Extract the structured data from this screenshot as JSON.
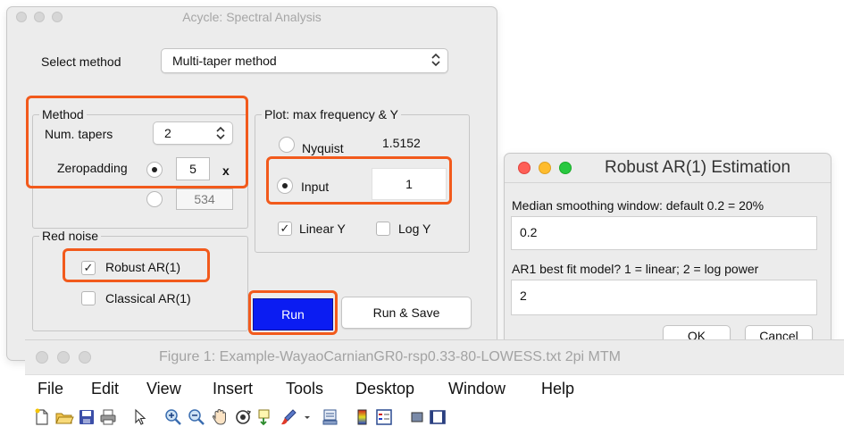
{
  "main_window": {
    "title": "Acycle: Spectral Analysis",
    "select_method_label": "Select method",
    "method_value": "Multi-taper method",
    "method_group": {
      "title": "Method",
      "num_tapers_label": "Num. tapers",
      "num_tapers_value": "2",
      "zeropadding_label": "Zeropadding",
      "zeropadding_value": "5",
      "zeropadding_unit": "x",
      "alt_value": "534"
    },
    "plot_group": {
      "title": "Plot: max frequency & Y",
      "nyquist_label": "Nyquist",
      "nyquist_value": "1.5152",
      "input_label": "Input",
      "input_value": "1",
      "linear_y_label": "Linear Y",
      "log_y_label": "Log Y"
    },
    "red_noise_group": {
      "title": "Red noise",
      "robust_label": "Robust AR(1)",
      "classical_label": "Classical AR(1)"
    },
    "run_label": "Run",
    "run_save_label": "Run & Save",
    "check_mark": "✓"
  },
  "dialog": {
    "title": "Robust AR(1) Estimation",
    "smoothing_prompt": "Median smoothing window: default 0.2 = 20%",
    "smoothing_value": "0.2",
    "model_prompt": "AR1 best fit model? 1 = linear; 2 = log power",
    "model_value": "2",
    "ok_label": "OK",
    "cancel_label": "Cancel"
  },
  "figure_window": {
    "title": "Figure 1: Example-WayaoCarnianGR0-rsp0.33-80-LOWESS.txt 2pi MTM",
    "menu": [
      "File",
      "Edit",
      "View",
      "Insert",
      "Tools",
      "Desktop",
      "Window",
      "Help"
    ],
    "toolbar_icons": [
      "new-figure-icon",
      "open-folder-icon",
      "save-icon",
      "print-icon",
      "pointer-icon",
      "zoom-in-icon",
      "zoom-out-icon",
      "pan-hand-icon",
      "rotate-3d-icon",
      "data-cursor-icon",
      "brush-icon",
      "link-plot-icon",
      "colorbar-icon",
      "legend-icon",
      "hide-plot-tools-icon",
      "show-plot-tools-icon"
    ]
  },
  "colors": {
    "highlight": "#f25a1c",
    "run_button": "#0b1cf2",
    "traffic_red": "#fe5f57",
    "traffic_yellow": "#febc2e",
    "traffic_green": "#28c840"
  }
}
